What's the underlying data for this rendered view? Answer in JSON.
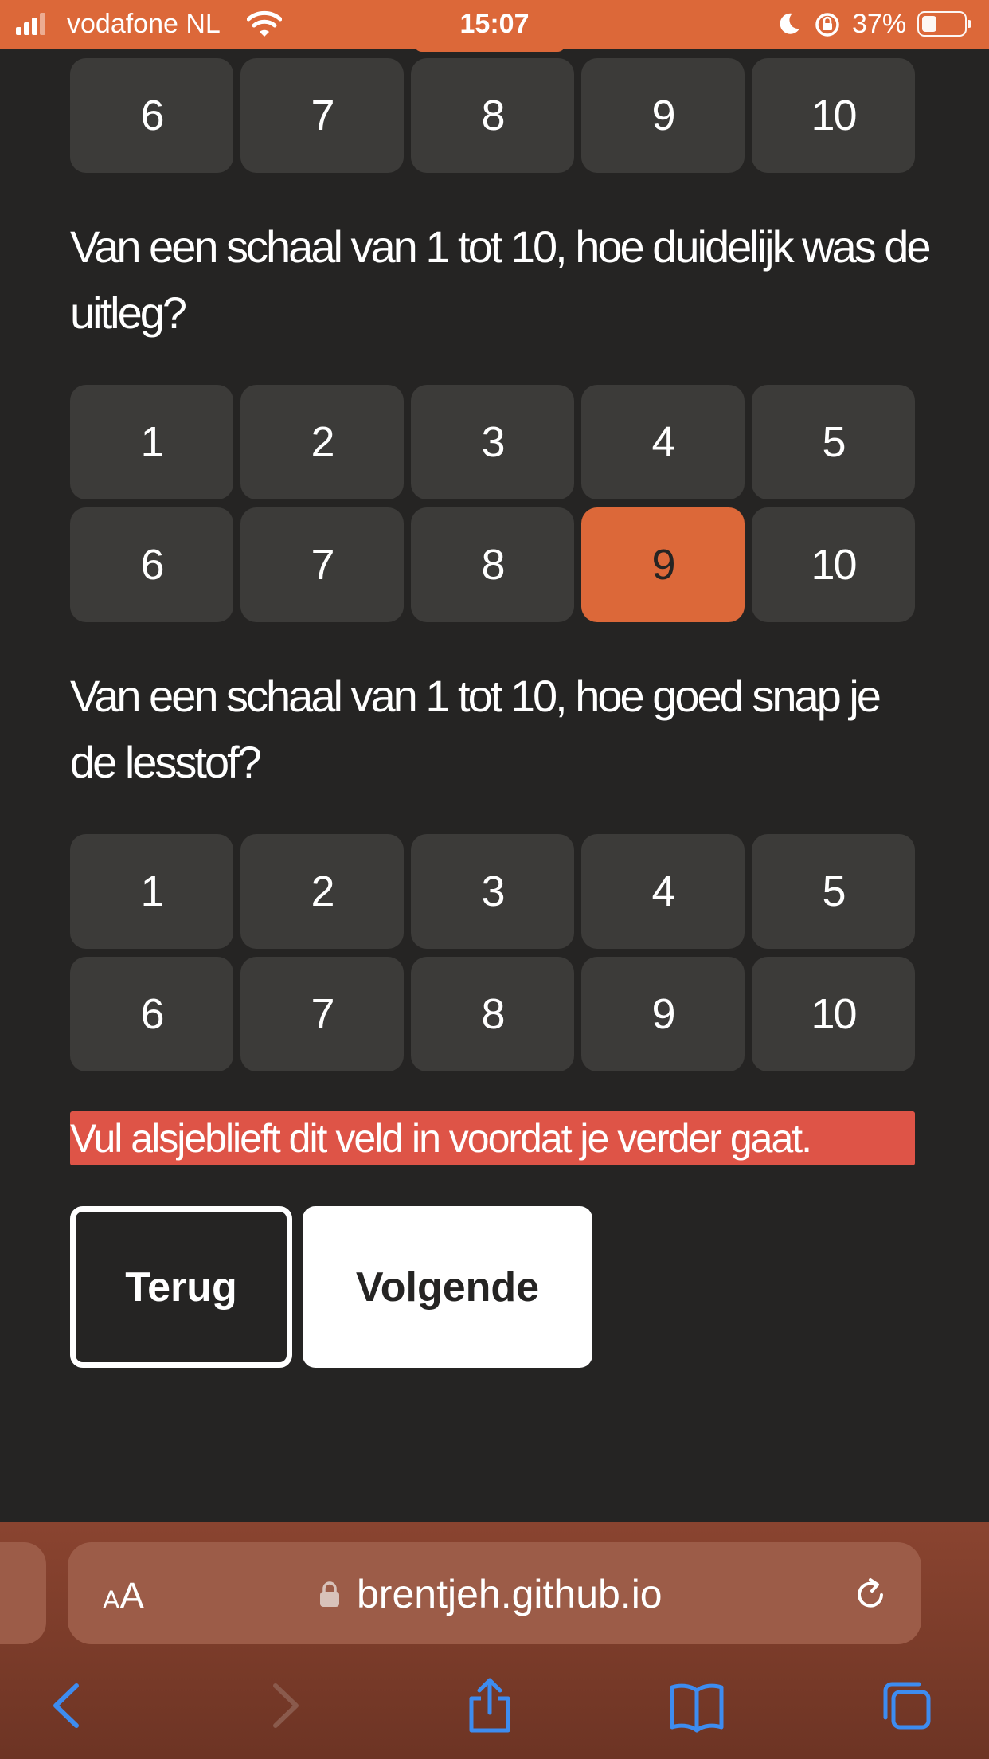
{
  "status_bar": {
    "carrier": "vodafone NL",
    "time": "15:07",
    "battery": "37%",
    "icons": [
      "signal-icon",
      "wifi-icon",
      "moon-icon",
      "orientation-lock-icon",
      "battery-icon"
    ]
  },
  "top_scale_row": [
    "6",
    "7",
    "8",
    "9",
    "10"
  ],
  "question_clarity": {
    "text": "Van een schaal van 1 tot 10, hoe duidelijk was de uitleg?",
    "options_row1": [
      "1",
      "2",
      "3",
      "4",
      "5"
    ],
    "options_row2": [
      "6",
      "7",
      "8",
      "9",
      "10"
    ],
    "selected": "9"
  },
  "question_understanding": {
    "text": "Van een schaal van 1 tot 10, hoe goed snap je de lesstof?",
    "options_row1": [
      "1",
      "2",
      "3",
      "4",
      "5"
    ],
    "options_row2": [
      "6",
      "7",
      "8",
      "9",
      "10"
    ],
    "selected": null
  },
  "error_message": "Vul alsjeblieft dit veld in voordat je verder gaat.",
  "buttons": {
    "back": "Terug",
    "next": "Volgende"
  },
  "browser": {
    "text_size_label_small": "A",
    "text_size_label_large": "A",
    "url": "brentjeh.github.io",
    "toolbar_icons": [
      "back-icon",
      "forward-icon",
      "share-icon",
      "bookmarks-icon",
      "tabs-icon"
    ]
  },
  "colors": {
    "accent": "#dc6839",
    "background": "#252423",
    "option": "#3c3b39",
    "error": "#de5447"
  }
}
